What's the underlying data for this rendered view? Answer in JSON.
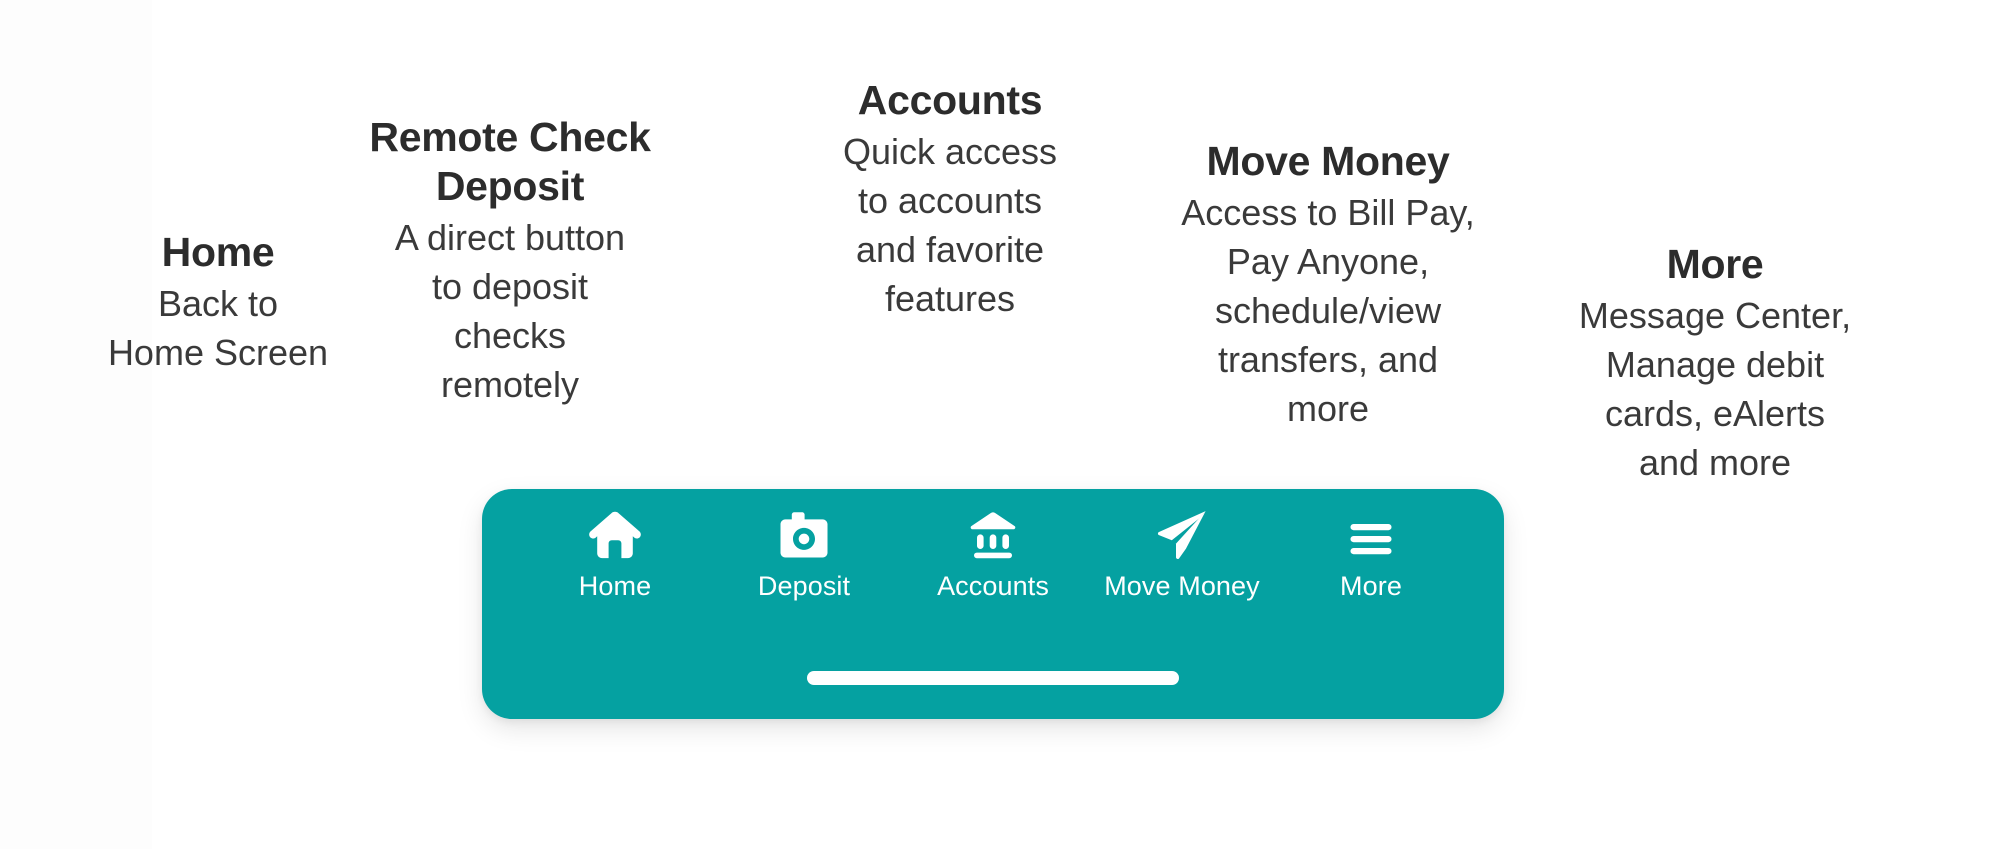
{
  "theme": {
    "background": "#ffffff",
    "nav_background": "#05A1A1",
    "nav_foreground": "#ffffff",
    "callout_title_color": "#2c2c2c",
    "callout_text_color": "#3a3a3a"
  },
  "callouts": [
    {
      "key": "home",
      "title": "Home",
      "description": "Back to\nHome Screen"
    },
    {
      "key": "deposit",
      "title": "Remote Check Deposit",
      "description": "A direct button\nto deposit\nchecks\nremotely"
    },
    {
      "key": "accounts",
      "title": "Accounts",
      "description": "Quick access\nto accounts\nand favorite\nfeatures"
    },
    {
      "key": "move_money",
      "title": "Move Money",
      "description": "Access to Bill Pay,\nPay Anyone,\nschedule/view\ntransfers, and\nmore"
    },
    {
      "key": "more",
      "title": "More",
      "description": "Message Center,\nManage debit\ncards, eAlerts\nand more"
    }
  ],
  "nav": {
    "items": [
      {
        "label": "Home",
        "icon": "home-icon"
      },
      {
        "label": "Deposit",
        "icon": "camera-icon"
      },
      {
        "label": "Accounts",
        "icon": "bank-icon"
      },
      {
        "label": "Move Money",
        "icon": "paper-plane-icon"
      },
      {
        "label": "More",
        "icon": "hamburger-menu-icon"
      }
    ],
    "home_indicator": "home-indicator-bar"
  }
}
